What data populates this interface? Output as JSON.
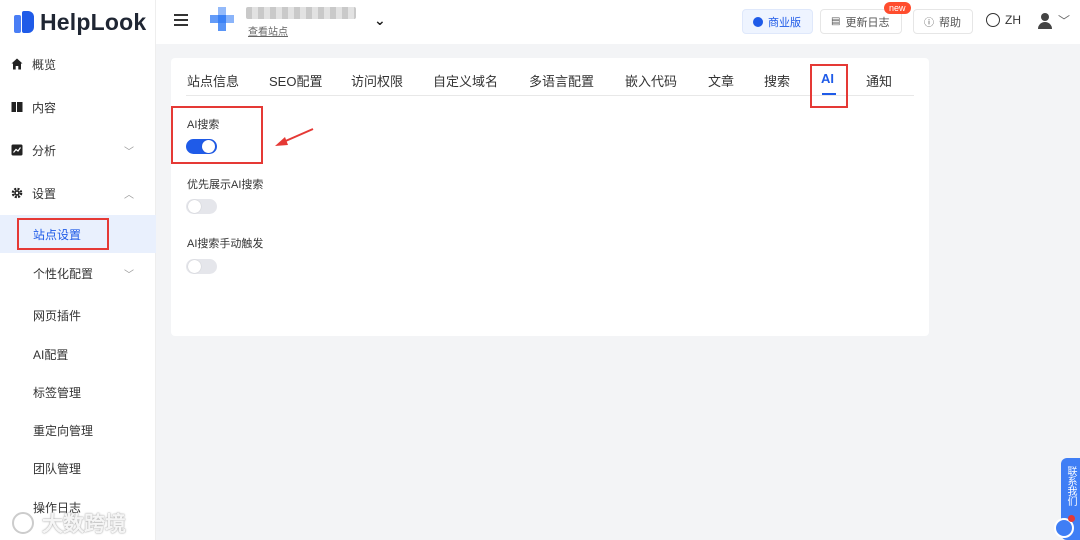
{
  "brand": {
    "name": "HelpLook"
  },
  "sidebar": {
    "items": [
      {
        "label": "概览",
        "icon": "home-icon"
      },
      {
        "label": "内容",
        "icon": "book-icon"
      },
      {
        "label": "分析",
        "icon": "chart-icon",
        "expandable": true
      },
      {
        "label": "设置",
        "icon": "gear-icon",
        "expanded": true
      }
    ],
    "sub_items": [
      {
        "label": "站点设置",
        "active": true
      },
      {
        "label": "个性化配置",
        "expandable": true
      },
      {
        "label": "网页插件"
      },
      {
        "label": "AI配置"
      },
      {
        "label": "标签管理"
      },
      {
        "label": "重定向管理"
      },
      {
        "label": "团队管理"
      },
      {
        "label": "操作日志"
      }
    ]
  },
  "header": {
    "view_site": "查看站点",
    "business_label": "商业版",
    "changelog_label": "更新日志",
    "new_badge": "new",
    "help_label": "帮助",
    "language": "ZH"
  },
  "tabs": [
    {
      "label": "站点信息"
    },
    {
      "label": "SEO配置"
    },
    {
      "label": "访问权限"
    },
    {
      "label": "自定义域名"
    },
    {
      "label": "多语言配置"
    },
    {
      "label": "嵌入代码"
    },
    {
      "label": "文章"
    },
    {
      "label": "搜索"
    },
    {
      "label": "AI",
      "active": true
    },
    {
      "label": "通知"
    }
  ],
  "settings": [
    {
      "label": "AI搜索",
      "enabled": true
    },
    {
      "label": "优先展示AI搜索",
      "enabled": false
    },
    {
      "label": "AI搜索手动触发",
      "enabled": false
    }
  ],
  "float": {
    "contact_label": "联系我们"
  },
  "watermark": "大数跨境",
  "colors": {
    "accent": "#1f5be8",
    "highlight_box": "#e53935"
  }
}
